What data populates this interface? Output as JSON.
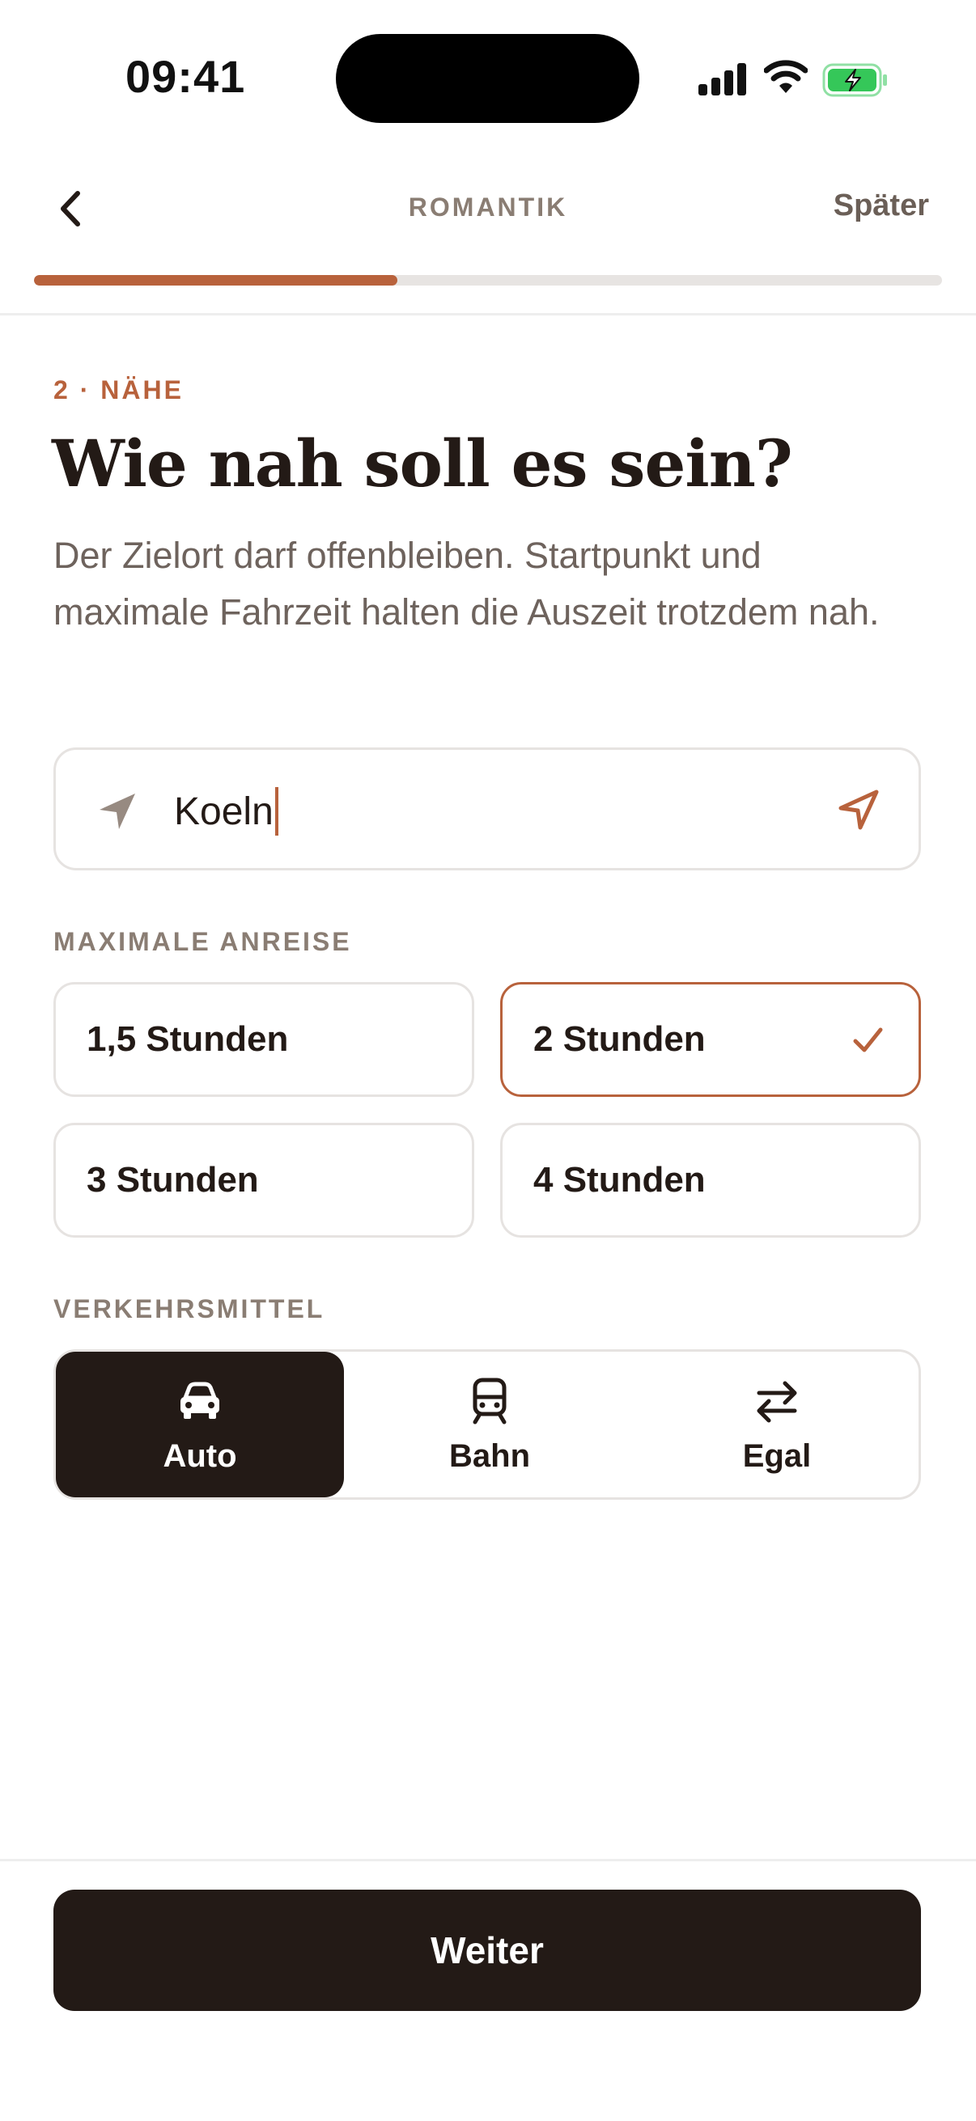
{
  "status_bar": {
    "time": "09:41"
  },
  "nav": {
    "title": "ROMANTIK",
    "later_label": "Später",
    "progress": 0.4
  },
  "step": {
    "label": "2 · NÄHE",
    "heading": "Wie nah soll es sein?",
    "description": "Der Zielort darf offenbleiben. Startpunkt und maximale Fahrzeit halten die Auszeit trotzdem nah."
  },
  "location": {
    "value": "Koeln",
    "icon": "navigation-arrow-icon",
    "action_icon": "locate-icon"
  },
  "travel_time": {
    "label": "MAXIMALE ANREISE",
    "options": [
      {
        "label": "1,5 Stunden",
        "selected": false
      },
      {
        "label": "2 Stunden",
        "selected": true
      },
      {
        "label": "3 Stunden",
        "selected": false
      },
      {
        "label": "4 Stunden",
        "selected": false
      }
    ]
  },
  "transport": {
    "label": "VERKEHRSMITTEL",
    "options": [
      {
        "label": "Auto",
        "icon": "car-icon",
        "selected": true
      },
      {
        "label": "Bahn",
        "icon": "train-icon",
        "selected": false
      },
      {
        "label": "Egal",
        "icon": "swap-arrows-icon",
        "selected": false
      }
    ]
  },
  "footer": {
    "primary_label": "Weiter"
  },
  "colors": {
    "accent": "#b8623c",
    "dark": "#231a16",
    "muted": "#8a7d73",
    "border": "#e6e3e1"
  }
}
